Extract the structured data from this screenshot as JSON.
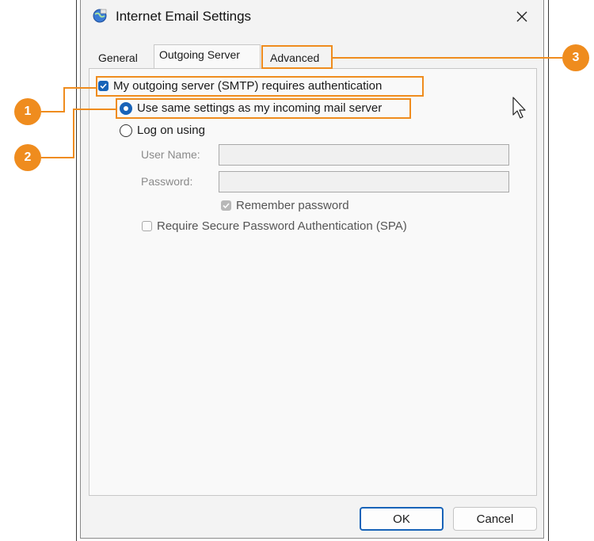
{
  "window": {
    "title": "Internet Email Settings",
    "icon": "globe-mail-icon",
    "close_icon": "close-icon"
  },
  "tabs": [
    {
      "label": "General",
      "active": false
    },
    {
      "label": "Outgoing Server",
      "active": true
    },
    {
      "label": "Advanced",
      "active": false
    }
  ],
  "outgoing": {
    "smtp_auth": {
      "label": "My outgoing server (SMTP) requires authentication",
      "checked": true
    },
    "same_settings": {
      "label": "Use same settings as my incoming mail server",
      "selected": true
    },
    "log_on": {
      "label": "Log on using",
      "selected": false
    },
    "username": {
      "label": "User Name:",
      "value": ""
    },
    "password": {
      "label": "Password:",
      "value": ""
    },
    "remember": {
      "label": "Remember password",
      "checked": true,
      "disabled": true
    },
    "spa": {
      "label": "Require Secure Password Authentication (SPA)",
      "checked": false,
      "disabled": true
    }
  },
  "buttons": {
    "ok": "OK",
    "cancel": "Cancel"
  },
  "callouts": [
    "1",
    "2",
    "3"
  ],
  "colors": {
    "accent": "#ef8c1e",
    "primary": "#1863b8"
  }
}
